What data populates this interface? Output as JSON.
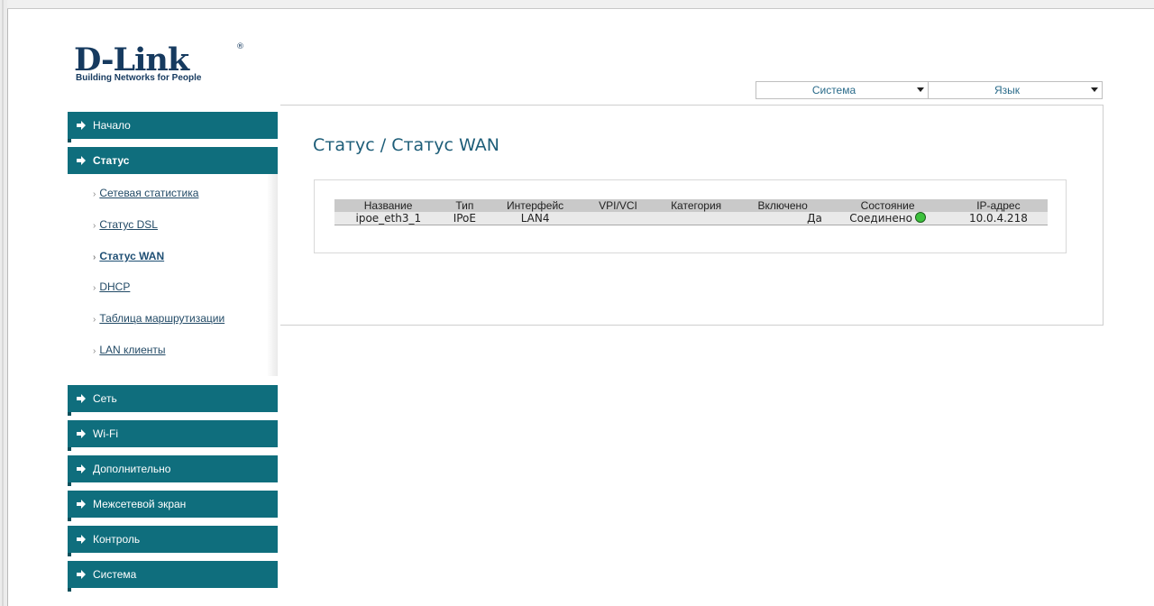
{
  "brand": {
    "name": "D-Link",
    "reg_mark": "®",
    "tagline": "Building Networks for People",
    "color": "#163a5f"
  },
  "topbar": {
    "system_label": "Система",
    "language_label": "Язык"
  },
  "sidebar": {
    "items": [
      {
        "label": "Начало"
      },
      {
        "label": "Статус"
      },
      {
        "label": "Сеть"
      },
      {
        "label": "Wi-Fi"
      },
      {
        "label": "Дополнительно"
      },
      {
        "label": "Межсетевой экран"
      },
      {
        "label": "Контроль"
      },
      {
        "label": "Система"
      }
    ],
    "status_sub": [
      {
        "label": "Сетевая статистика"
      },
      {
        "label": "Статус DSL"
      },
      {
        "label": "Статус WAN"
      },
      {
        "label": "DHCP"
      },
      {
        "label": "Таблица маршрутизации"
      },
      {
        "label": "LAN клиенты"
      }
    ],
    "accent_color": "#0f6e7d"
  },
  "main": {
    "title": "Статус / Статус WAN",
    "table": {
      "headers": [
        "Название",
        "Тип",
        "Интерфейс",
        "VPI/VCI",
        "Категория",
        "Включено",
        "Состояние",
        "IP-адрес"
      ],
      "rows": [
        {
          "name": "ipoe_eth3_1",
          "type": "IPoE",
          "interface": "LAN4",
          "vpivci": "",
          "category": "",
          "enabled": "Да",
          "state": "Соединено",
          "ip": "10.0.4.218"
        }
      ]
    },
    "status_color": "#3cc13c"
  }
}
